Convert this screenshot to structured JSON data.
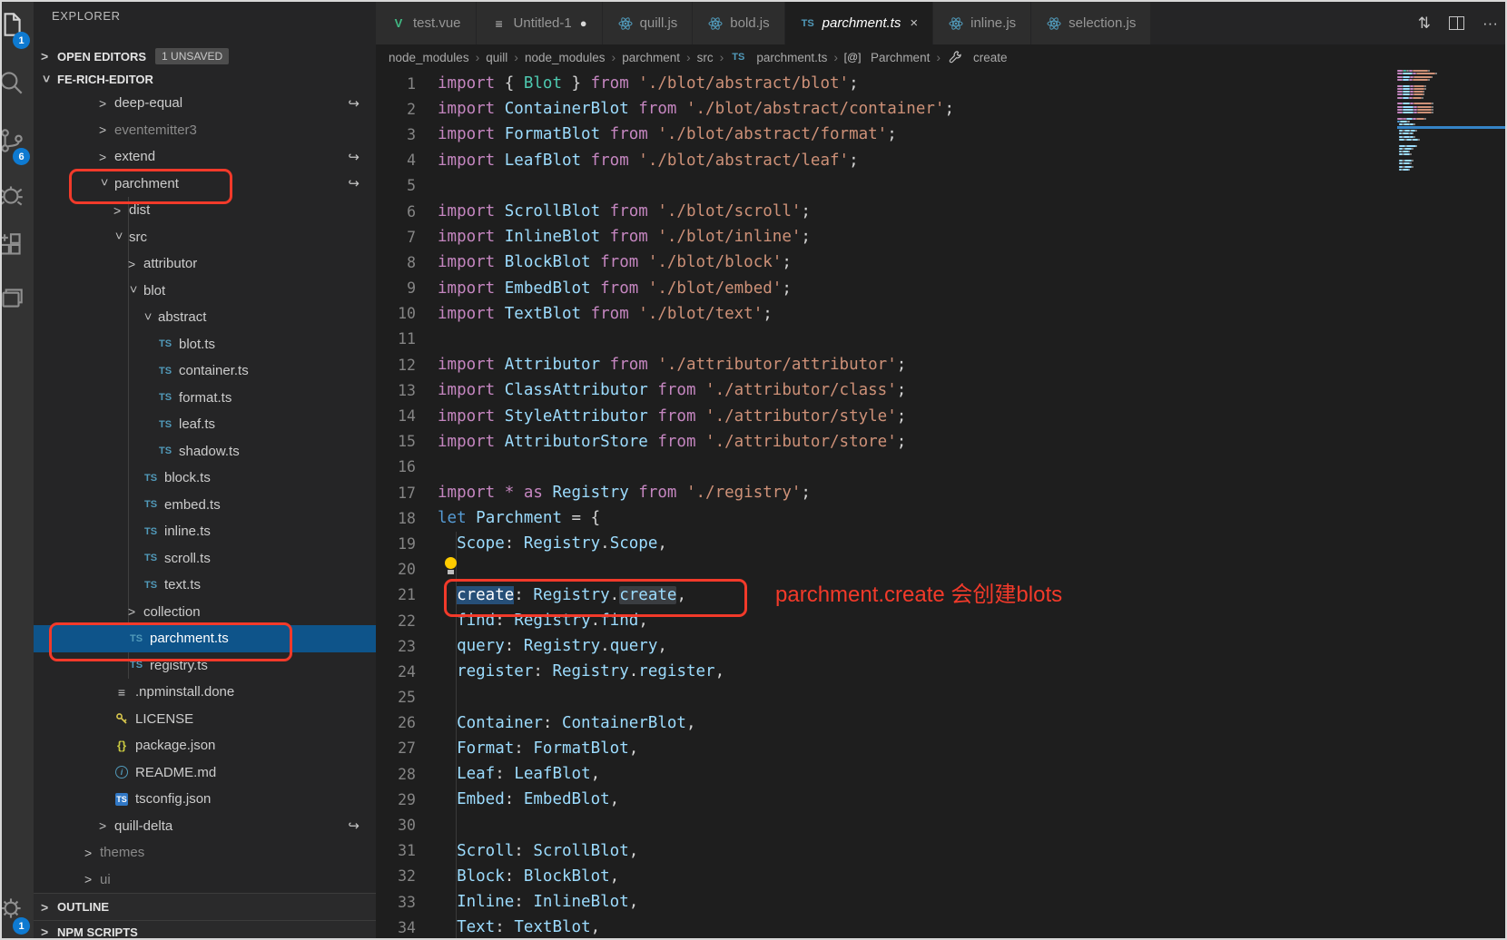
{
  "colors": {
    "accent": "#0e7ad1",
    "annotation_red": "#f23a2a",
    "selected_row_blue": "#0e548a",
    "selection_bg": "#264f78",
    "tokens": {
      "k": "#c586c0",
      "d": "#569cd6",
      "b": "#9cdcfe",
      "t": "#4ec9b0",
      "s": "#ce9178",
      "p": "#d4d4d4"
    }
  },
  "activity_bar": {
    "items": [
      {
        "icon": "files-icon",
        "badge": "1"
      },
      {
        "icon": "search-icon"
      },
      {
        "icon": "source-control-icon",
        "badge": "6"
      },
      {
        "icon": "debug-icon"
      },
      {
        "icon": "extensions-icon"
      },
      {
        "icon": "project-icon"
      }
    ],
    "bottom_items": [
      {
        "icon": "gear-icon",
        "badge": "1"
      }
    ]
  },
  "sidebar": {
    "title": "EXPLORER",
    "open_editors": {
      "label": "OPEN EDITORS",
      "badge": "1 UNSAVED"
    },
    "root_label": "FE-RICH-EDITOR",
    "tree": [
      {
        "label": "deep-equal",
        "level": 0,
        "chevron": "closed",
        "symlink": true
      },
      {
        "label": "eventemitter3",
        "level": 0,
        "chevron": "closed",
        "dim": true
      },
      {
        "label": "extend",
        "level": 0,
        "chevron": "closed",
        "symlink": true
      },
      {
        "label": "parchment",
        "level": 0,
        "chevron": "open",
        "symlink": true,
        "annotated": true
      },
      {
        "label": "dist",
        "level": 1,
        "chevron": "closed"
      },
      {
        "label": "src",
        "level": 1,
        "chevron": "open"
      },
      {
        "label": "attributor",
        "level": 2,
        "chevron": "closed"
      },
      {
        "label": "blot",
        "level": 2,
        "chevron": "open"
      },
      {
        "label": "abstract",
        "level": 3,
        "chevron": "open"
      },
      {
        "label": "blot.ts",
        "level": 4,
        "icon": "ts"
      },
      {
        "label": "container.ts",
        "level": 4,
        "icon": "ts"
      },
      {
        "label": "format.ts",
        "level": 4,
        "icon": "ts"
      },
      {
        "label": "leaf.ts",
        "level": 4,
        "icon": "ts"
      },
      {
        "label": "shadow.ts",
        "level": 4,
        "icon": "ts"
      },
      {
        "label": "block.ts",
        "level": 3,
        "icon": "ts"
      },
      {
        "label": "embed.ts",
        "level": 3,
        "icon": "ts"
      },
      {
        "label": "inline.ts",
        "level": 3,
        "icon": "ts"
      },
      {
        "label": "scroll.ts",
        "level": 3,
        "icon": "ts"
      },
      {
        "label": "text.ts",
        "level": 3,
        "icon": "ts"
      },
      {
        "label": "collection",
        "level": 2,
        "chevron": "closed"
      },
      {
        "label": "parchment.ts",
        "level": 2,
        "icon": "ts",
        "selected": true,
        "annotated": true
      },
      {
        "label": "registry.ts",
        "level": 2,
        "icon": "ts"
      },
      {
        "label": ".npminstall.done",
        "level": 1,
        "icon": "list"
      },
      {
        "label": "LICENSE",
        "level": 1,
        "icon": "key"
      },
      {
        "label": "package.json",
        "level": 1,
        "icon": "braces"
      },
      {
        "label": "README.md",
        "level": 1,
        "icon": "info"
      },
      {
        "label": "tsconfig.json",
        "level": 1,
        "icon": "ts-badge"
      },
      {
        "label": "quill-delta",
        "level": 0,
        "chevron": "closed",
        "symlink": true
      },
      {
        "label": "themes",
        "level": -1,
        "chevron": "closed",
        "dim": true
      },
      {
        "label": "ui",
        "level": -1,
        "chevron": "closed",
        "dim": true
      }
    ],
    "bottom_sections": [
      "OUTLINE",
      "NPM SCRIPTS"
    ]
  },
  "tabs": [
    {
      "label": "test.vue",
      "icon": "vue"
    },
    {
      "label": "Untitled-1",
      "icon": "plain",
      "modified": true
    },
    {
      "label": "quill.js",
      "icon": "js-atom"
    },
    {
      "label": "bold.js",
      "icon": "js-atom"
    },
    {
      "label": "parchment.ts",
      "icon": "ts",
      "active": true,
      "closable": true
    },
    {
      "label": "inline.js",
      "icon": "js-atom"
    },
    {
      "label": "selection.js",
      "icon": "js-atom"
    }
  ],
  "tab_actions": [
    {
      "name": "open-changes-icon",
      "glyph": "⇅"
    },
    {
      "name": "split-editor-icon",
      "glyph": ""
    },
    {
      "name": "more-actions-icon",
      "glyph": "···"
    }
  ],
  "breadcrumb": [
    {
      "label": "node_modules"
    },
    {
      "label": "quill"
    },
    {
      "label": "node_modules"
    },
    {
      "label": "parchment"
    },
    {
      "label": "src"
    },
    {
      "label": "parchment.ts",
      "icon": "ts"
    },
    {
      "label": "Parchment",
      "icon": "namespace"
    },
    {
      "label": "create",
      "icon": "wrench"
    }
  ],
  "editor": {
    "annotation": "parchment.create 会创建blots",
    "lines": [
      {
        "n": 1,
        "t": [
          [
            "k",
            "import "
          ],
          [
            "p",
            "{ "
          ],
          [
            "t",
            "Blot"
          ],
          [
            "p",
            " } "
          ],
          [
            "k",
            "from "
          ],
          [
            "s",
            "'./blot/abstract/blot'"
          ],
          [
            "p",
            ";"
          ]
        ]
      },
      {
        "n": 2,
        "t": [
          [
            "k",
            "import "
          ],
          [
            "b",
            "ContainerBlot "
          ],
          [
            "k",
            "from "
          ],
          [
            "s",
            "'./blot/abstract/container'"
          ],
          [
            "p",
            ";"
          ]
        ]
      },
      {
        "n": 3,
        "t": [
          [
            "k",
            "import "
          ],
          [
            "b",
            "FormatBlot "
          ],
          [
            "k",
            "from "
          ],
          [
            "s",
            "'./blot/abstract/format'"
          ],
          [
            "p",
            ";"
          ]
        ]
      },
      {
        "n": 4,
        "t": [
          [
            "k",
            "import "
          ],
          [
            "b",
            "LeafBlot "
          ],
          [
            "k",
            "from "
          ],
          [
            "s",
            "'./blot/abstract/leaf'"
          ],
          [
            "p",
            ";"
          ]
        ]
      },
      {
        "n": 5,
        "t": []
      },
      {
        "n": 6,
        "t": [
          [
            "k",
            "import "
          ],
          [
            "b",
            "ScrollBlot "
          ],
          [
            "k",
            "from "
          ],
          [
            "s",
            "'./blot/scroll'"
          ],
          [
            "p",
            ";"
          ]
        ]
      },
      {
        "n": 7,
        "t": [
          [
            "k",
            "import "
          ],
          [
            "b",
            "InlineBlot "
          ],
          [
            "k",
            "from "
          ],
          [
            "s",
            "'./blot/inline'"
          ],
          [
            "p",
            ";"
          ]
        ]
      },
      {
        "n": 8,
        "t": [
          [
            "k",
            "import "
          ],
          [
            "b",
            "BlockBlot "
          ],
          [
            "k",
            "from "
          ],
          [
            "s",
            "'./blot/block'"
          ],
          [
            "p",
            ";"
          ]
        ]
      },
      {
        "n": 9,
        "t": [
          [
            "k",
            "import "
          ],
          [
            "b",
            "EmbedBlot "
          ],
          [
            "k",
            "from "
          ],
          [
            "s",
            "'./blot/embed'"
          ],
          [
            "p",
            ";"
          ]
        ]
      },
      {
        "n": 10,
        "t": [
          [
            "k",
            "import "
          ],
          [
            "b",
            "TextBlot "
          ],
          [
            "k",
            "from "
          ],
          [
            "s",
            "'./blot/text'"
          ],
          [
            "p",
            ";"
          ]
        ]
      },
      {
        "n": 11,
        "t": []
      },
      {
        "n": 12,
        "t": [
          [
            "k",
            "import "
          ],
          [
            "b",
            "Attributor "
          ],
          [
            "k",
            "from "
          ],
          [
            "s",
            "'./attributor/attributor'"
          ],
          [
            "p",
            ";"
          ]
        ]
      },
      {
        "n": 13,
        "t": [
          [
            "k",
            "import "
          ],
          [
            "b",
            "ClassAttributor "
          ],
          [
            "k",
            "from "
          ],
          [
            "s",
            "'./attributor/class'"
          ],
          [
            "p",
            ";"
          ]
        ]
      },
      {
        "n": 14,
        "t": [
          [
            "k",
            "import "
          ],
          [
            "b",
            "StyleAttributor "
          ],
          [
            "k",
            "from "
          ],
          [
            "s",
            "'./attributor/style'"
          ],
          [
            "p",
            ";"
          ]
        ]
      },
      {
        "n": 15,
        "t": [
          [
            "k",
            "import "
          ],
          [
            "b",
            "AttributorStore "
          ],
          [
            "k",
            "from "
          ],
          [
            "s",
            "'./attributor/store'"
          ],
          [
            "p",
            ";"
          ]
        ]
      },
      {
        "n": 16,
        "t": []
      },
      {
        "n": 17,
        "t": [
          [
            "k",
            "import "
          ],
          [
            "k",
            "* "
          ],
          [
            "k",
            "as "
          ],
          [
            "b",
            "Registry "
          ],
          [
            "k",
            "from "
          ],
          [
            "s",
            "'./registry'"
          ],
          [
            "p",
            ";"
          ]
        ]
      },
      {
        "n": 18,
        "t": [
          [
            "d",
            "let "
          ],
          [
            "b",
            "Parchment "
          ],
          [
            "p",
            "= {"
          ]
        ]
      },
      {
        "n": 19,
        "t": [
          [
            "p",
            "  "
          ],
          [
            "b",
            "Scope"
          ],
          [
            "p",
            ": "
          ],
          [
            "b",
            "Registry"
          ],
          [
            "p",
            "."
          ],
          [
            "b",
            "Scope"
          ],
          [
            "p",
            ","
          ]
        ]
      },
      {
        "n": 20,
        "t": [],
        "bulb": true
      },
      {
        "n": 21,
        "t": [
          [
            "p",
            "  "
          ],
          [
            "sel",
            "create"
          ],
          [
            "p",
            ": "
          ],
          [
            "b",
            "Registry"
          ],
          [
            "p",
            "."
          ],
          [
            "hl",
            "create"
          ],
          [
            "p",
            ","
          ]
        ],
        "annotated": true
      },
      {
        "n": 22,
        "t": [
          [
            "p",
            "  "
          ],
          [
            "b",
            "find"
          ],
          [
            "p",
            ": "
          ],
          [
            "b",
            "Registry"
          ],
          [
            "p",
            "."
          ],
          [
            "b",
            "find"
          ],
          [
            "p",
            ","
          ]
        ]
      },
      {
        "n": 23,
        "t": [
          [
            "p",
            "  "
          ],
          [
            "b",
            "query"
          ],
          [
            "p",
            ": "
          ],
          [
            "b",
            "Registry"
          ],
          [
            "p",
            "."
          ],
          [
            "b",
            "query"
          ],
          [
            "p",
            ","
          ]
        ]
      },
      {
        "n": 24,
        "t": [
          [
            "p",
            "  "
          ],
          [
            "b",
            "register"
          ],
          [
            "p",
            ": "
          ],
          [
            "b",
            "Registry"
          ],
          [
            "p",
            "."
          ],
          [
            "b",
            "register"
          ],
          [
            "p",
            ","
          ]
        ]
      },
      {
        "n": 25,
        "t": []
      },
      {
        "n": 26,
        "t": [
          [
            "p",
            "  "
          ],
          [
            "b",
            "Container"
          ],
          [
            "p",
            ": "
          ],
          [
            "b",
            "ContainerBlot"
          ],
          [
            "p",
            ","
          ]
        ]
      },
      {
        "n": 27,
        "t": [
          [
            "p",
            "  "
          ],
          [
            "b",
            "Format"
          ],
          [
            "p",
            ": "
          ],
          [
            "b",
            "FormatBlot"
          ],
          [
            "p",
            ","
          ]
        ]
      },
      {
        "n": 28,
        "t": [
          [
            "p",
            "  "
          ],
          [
            "b",
            "Leaf"
          ],
          [
            "p",
            ": "
          ],
          [
            "b",
            "LeafBlot"
          ],
          [
            "p",
            ","
          ]
        ]
      },
      {
        "n": 29,
        "t": [
          [
            "p",
            "  "
          ],
          [
            "b",
            "Embed"
          ],
          [
            "p",
            ": "
          ],
          [
            "b",
            "EmbedBlot"
          ],
          [
            "p",
            ","
          ]
        ]
      },
      {
        "n": 30,
        "t": []
      },
      {
        "n": 31,
        "t": [
          [
            "p",
            "  "
          ],
          [
            "b",
            "Scroll"
          ],
          [
            "p",
            ": "
          ],
          [
            "b",
            "ScrollBlot"
          ],
          [
            "p",
            ","
          ]
        ]
      },
      {
        "n": 32,
        "t": [
          [
            "p",
            "  "
          ],
          [
            "b",
            "Block"
          ],
          [
            "p",
            ": "
          ],
          [
            "b",
            "BlockBlot"
          ],
          [
            "p",
            ","
          ]
        ]
      },
      {
        "n": 33,
        "t": [
          [
            "p",
            "  "
          ],
          [
            "b",
            "Inline"
          ],
          [
            "p",
            ": "
          ],
          [
            "b",
            "InlineBlot"
          ],
          [
            "p",
            ","
          ]
        ]
      },
      {
        "n": 34,
        "t": [
          [
            "p",
            "  "
          ],
          [
            "b",
            "Text"
          ],
          [
            "p",
            ": "
          ],
          [
            "b",
            "TextBlot"
          ],
          [
            "p",
            ","
          ]
        ]
      }
    ]
  }
}
